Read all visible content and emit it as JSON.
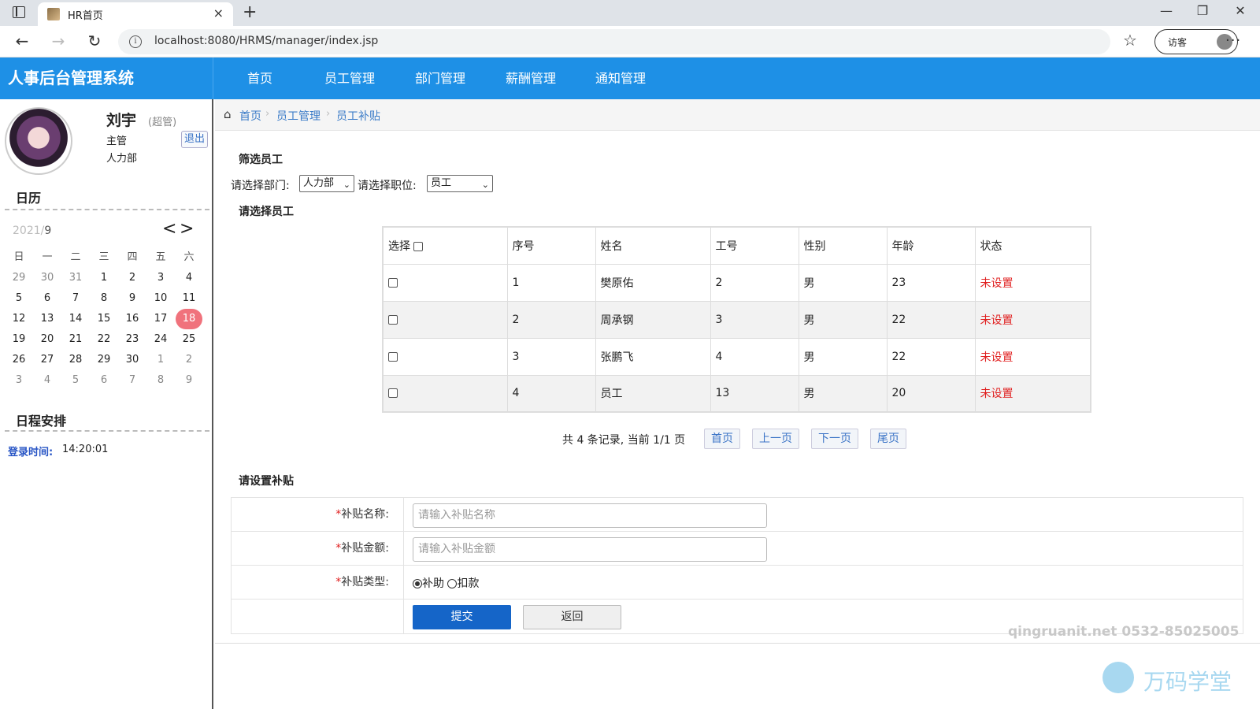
{
  "browser": {
    "tab_title": "HR首页",
    "tab_close": "×",
    "new_tab": "+",
    "minimize": "—",
    "restore": "❐",
    "close": "✕",
    "back": "←",
    "forward": "→",
    "reload": "↻",
    "info": "i",
    "url": "localhost:8080/HRMS/manager/index.jsp",
    "favorites": "☆",
    "guest_label": "访客",
    "more": "···"
  },
  "app": {
    "brand": "人事后台管理系统",
    "nav": [
      "首页",
      "员工管理",
      "部门管理",
      "薪酬管理",
      "通知管理"
    ]
  },
  "user": {
    "name": "刘宇",
    "role_tag": "(超管)",
    "title": "主管",
    "dept": "人力部",
    "logout": "退出"
  },
  "calendar": {
    "section_title": "日历",
    "year": "2021/",
    "month": "9",
    "prev": "<",
    "next": ">",
    "weekdays": [
      "日",
      "一",
      "二",
      "三",
      "四",
      "五",
      "六"
    ],
    "weeks": [
      [
        "29",
        "30",
        "31",
        "1",
        "2",
        "3",
        "4"
      ],
      [
        "5",
        "6",
        "7",
        "8",
        "9",
        "10",
        "11"
      ],
      [
        "12",
        "13",
        "14",
        "15",
        "16",
        "17",
        "18"
      ],
      [
        "19",
        "20",
        "21",
        "22",
        "23",
        "24",
        "25"
      ],
      [
        "26",
        "27",
        "28",
        "29",
        "30",
        "1",
        "2"
      ],
      [
        "3",
        "4",
        "5",
        "6",
        "7",
        "8",
        "9"
      ]
    ],
    "today": "18"
  },
  "schedule": {
    "section_title": "日程安排",
    "login_label": "登录时间:",
    "login_time": "14:20:01"
  },
  "breadcrumb": [
    "首页",
    "员工管理",
    "员工补贴"
  ],
  "filter": {
    "title": "筛选员工",
    "dept_label": "请选择部门:",
    "dept_value": "人力部",
    "pos_label": "请选择职位:",
    "pos_value": "员工",
    "select_title": "请选择员工"
  },
  "table": {
    "headers": [
      "选择",
      "序号",
      "姓名",
      "工号",
      "性别",
      "年龄",
      "状态"
    ],
    "rows": [
      [
        "1",
        "樊原佑",
        "2",
        "男",
        "23",
        "未设置"
      ],
      [
        "2",
        "周承钢",
        "3",
        "男",
        "22",
        "未设置"
      ],
      [
        "3",
        "张鹏飞",
        "4",
        "男",
        "22",
        "未设置"
      ],
      [
        "4",
        "员工",
        "13",
        "男",
        "20",
        "未设置"
      ]
    ],
    "status_color": "#e02020"
  },
  "pager": {
    "info": "共 4 条记录,  当前 1/1 页",
    "first": "首页",
    "prev": "上一页",
    "next": "下一页",
    "last": "尾页"
  },
  "subsidy_form": {
    "title": "请设置补贴",
    "required_mark": "*",
    "name_label": "补贴名称:",
    "name_placeholder": "请输入补贴名称",
    "amount_label": "补贴金额:",
    "amount_placeholder": "请输入补贴金额",
    "type_label": "补贴类型:",
    "type_options": [
      "补助",
      "扣款"
    ],
    "type_selected": "补助",
    "submit": "提交",
    "back": "返回"
  },
  "watermark": {
    "line": "qingruanit.net 0532-85025005",
    "brand": "万码学堂"
  },
  "colors": {
    "header_blue": "#1e90e6",
    "submit_blue": "#1565c8",
    "today_pink": "#f0727c",
    "link_blue": "#3a7bc8"
  }
}
